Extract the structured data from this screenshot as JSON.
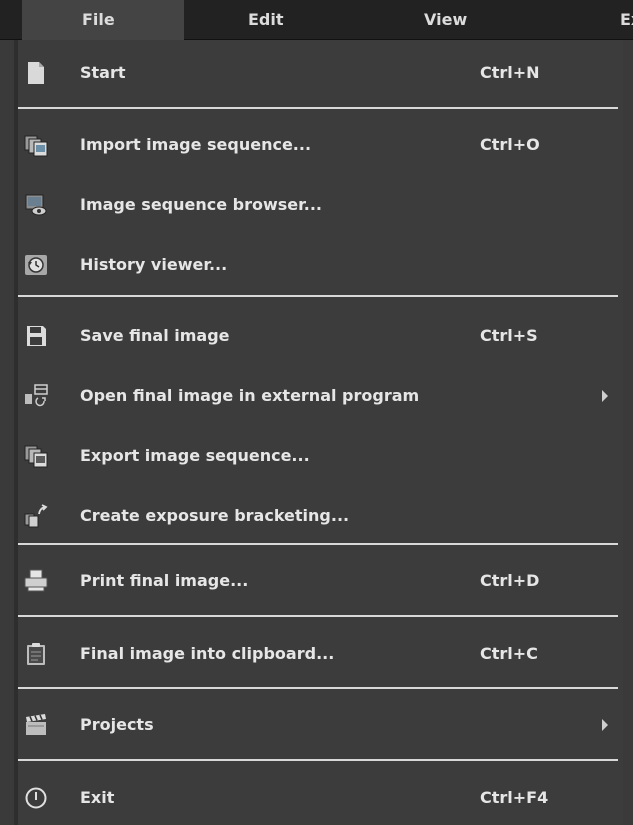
{
  "menubar": {
    "tabs": [
      "File",
      "Edit",
      "View",
      "Ex"
    ]
  },
  "file_menu": {
    "items": [
      {
        "label": "Start",
        "shortcut": "Ctrl+N",
        "icon": "blank-page-icon"
      },
      {
        "label": "Import image sequence...",
        "shortcut": "Ctrl+O",
        "icon": "import-images-icon"
      },
      {
        "label": "Image sequence browser...",
        "shortcut": "",
        "icon": "browser-icon"
      },
      {
        "label": "History viewer...",
        "shortcut": "",
        "icon": "history-icon"
      },
      {
        "label": "Save final image",
        "shortcut": "Ctrl+S",
        "icon": "save-icon"
      },
      {
        "label": "Open final image in external program",
        "shortcut": "",
        "icon": "external-program-icon",
        "submenu": true
      },
      {
        "label": "Export image sequence...",
        "shortcut": "",
        "icon": "export-images-icon"
      },
      {
        "label": "Create exposure bracketing...",
        "shortcut": "",
        "icon": "bracketing-icon"
      },
      {
        "label": "Print final image...",
        "shortcut": "Ctrl+D",
        "icon": "printer-icon"
      },
      {
        "label": "Final image into clipboard...",
        "shortcut": "Ctrl+C",
        "icon": "clipboard-icon"
      },
      {
        "label": "Projects",
        "shortcut": "",
        "icon": "clapperboard-icon",
        "submenu": true
      },
      {
        "label": "Exit",
        "shortcut": "Ctrl+F4",
        "icon": "power-icon"
      }
    ]
  }
}
